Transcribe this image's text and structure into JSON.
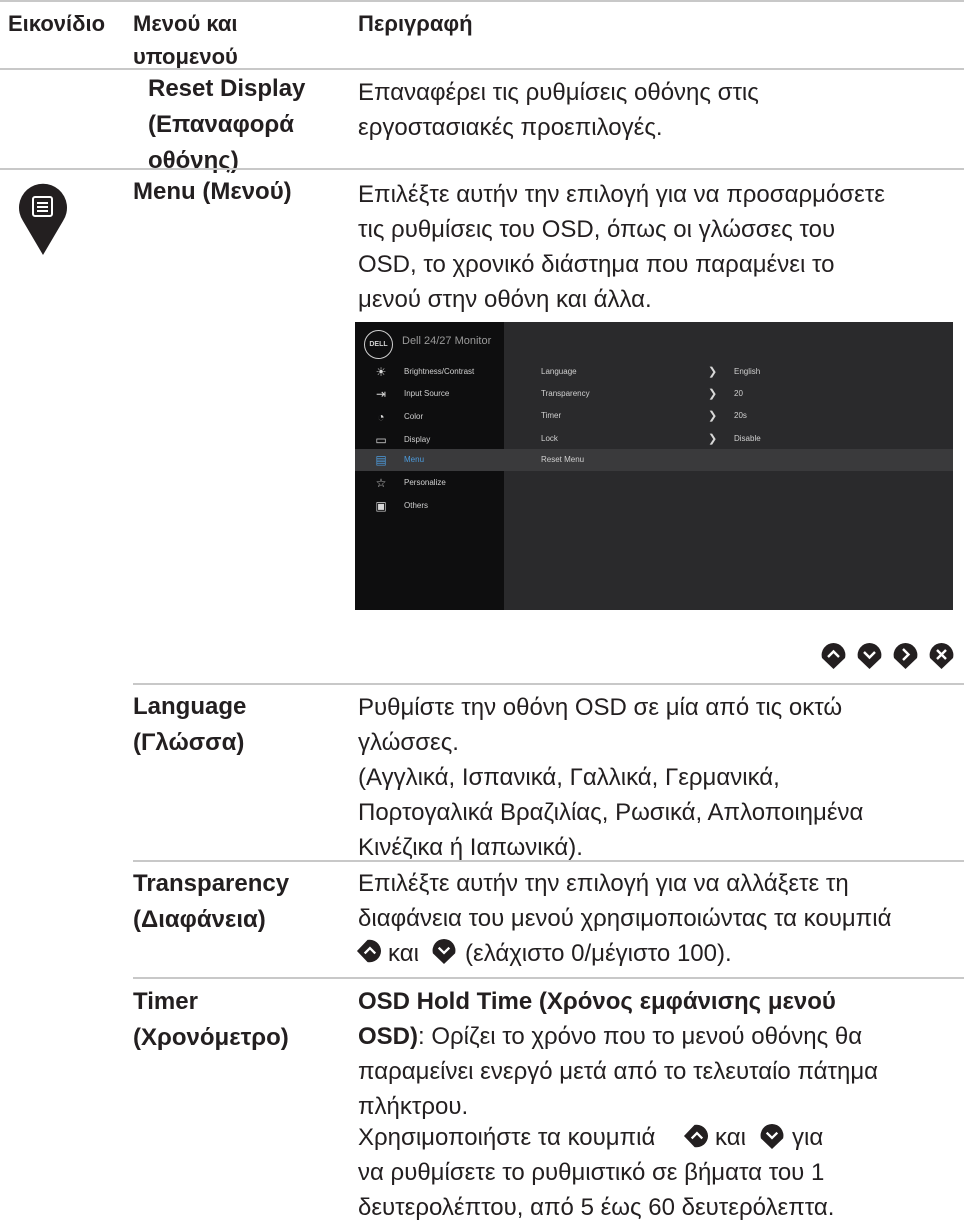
{
  "header": {
    "col_icon": "Εικονίδιο",
    "col_menu": "Μενού και\nυπομενού",
    "col_desc": "Περιγραφή"
  },
  "rows": {
    "reset_display": {
      "name": "Reset Display\n(Επαναφορά\nοθόνης)",
      "desc": "Επαναφέρει τις ρυθμίσεις οθόνης στις\nεργοστασιακές προεπιλογές."
    },
    "menu": {
      "name": "Menu (Μενού)",
      "desc": "Επιλέξτε αυτήν την επιλογή για να προσαρμόσετε\nτις ρυθμίσεις του OSD, όπως οι γλώσσες του\nOSD, το χρονικό διάστημα που παραμένει το\nμενού στην οθόνη και άλλα."
    },
    "language": {
      "name": "Language\n(Γλώσσα)",
      "desc": "Ρυθμίστε την οθόνη OSD σε μία από τις οκτώ\nγλώσσες.\n(Αγγλικά, Ισπανικά, Γαλλικά, Γερμανικά,\nΠορτογαλικά Βραζιλίας, Ρωσικά, Απλοποιημένα\nΚινέζικα ή Ιαπωνικά)."
    },
    "transparency": {
      "name": "Transparency\n(Διαφάνεια)",
      "desc_line1": "Επιλέξτε αυτήν την επιλογή για να αλλάξετε τη",
      "desc_line2": "διαφάνεια του μενού χρησιμοποιώντας τα κουμπιά",
      "desc_line3_mid": "και",
      "desc_line3_end": "(ελάχιστο 0/μέγιστο 100)."
    },
    "timer": {
      "name": "Timer\n(Χρονόμετρο)",
      "hold_bold": "OSD Hold Time (Χρόνος εμφάνισης μενού\nOSD)",
      "hold_rest": ": Ορίζει το χρόνο που το μενού οθόνης θα\nπαραμείνει ενεργό μετά από το τελευταίο πάτημα\nπλήκτρου.",
      "use_start": "Χρησιμοποιήστε τα κουμπιά",
      "use_mid": "και",
      "use_end": "για",
      "use_rest": "να ρυθμίσετε το ρυθμιστικό σε βήματα του 1\nδευτερολέπτου, από 5 έως 60 δευτερόλεπτα."
    }
  },
  "osd": {
    "logo": "DELL",
    "title": "Dell 24/27 Monitor",
    "menu_items": [
      {
        "icon": "brightness-icon",
        "glyph": "☀",
        "label": "Brightness/Contrast"
      },
      {
        "icon": "input-source-icon",
        "glyph": "⇥",
        "label": "Input Source"
      },
      {
        "icon": "color-icon",
        "glyph": "◔",
        "label": "Color"
      },
      {
        "icon": "display-icon",
        "glyph": "▭",
        "label": "Display"
      },
      {
        "icon": "menu-icon",
        "glyph": "▤",
        "label": "Menu"
      },
      {
        "icon": "personalize-icon",
        "glyph": "☆",
        "label": "Personalize"
      },
      {
        "icon": "others-icon",
        "glyph": "▣",
        "label": "Others"
      }
    ],
    "selected_index": 4,
    "settings": [
      {
        "label": "Language",
        "value": "English"
      },
      {
        "label": "Transparency",
        "value": "20"
      },
      {
        "label": "Timer",
        "value": "20s"
      },
      {
        "label": "Lock",
        "value": "Disable"
      },
      {
        "label": "Reset Menu",
        "value": ""
      }
    ],
    "accent": "#4d9bdc"
  },
  "nav_buttons": [
    "up-button-icon",
    "down-button-icon",
    "right-button-icon",
    "close-button-icon"
  ]
}
